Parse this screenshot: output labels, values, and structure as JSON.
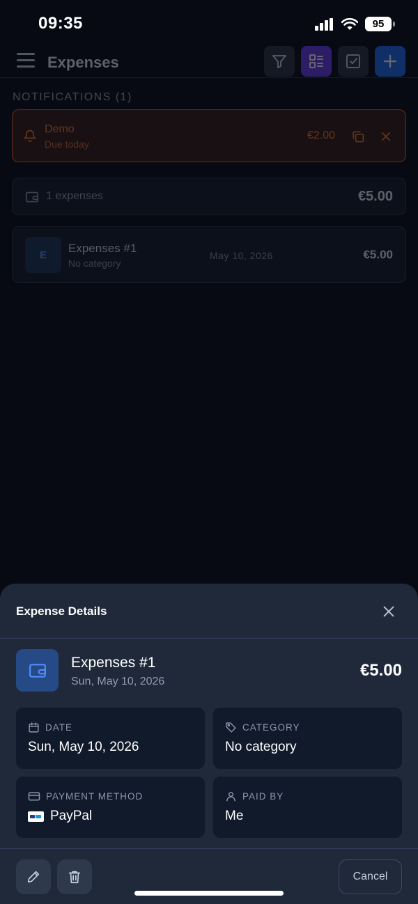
{
  "status_bar": {
    "time": "09:35",
    "battery": "95"
  },
  "header": {
    "title": "Expenses"
  },
  "notifications": {
    "label": "NOTIFICATIONS (1)",
    "items": [
      {
        "name": "Demo",
        "subtitle": "Due today",
        "amount": "€2.00"
      }
    ]
  },
  "summary": {
    "count_label": "1 expenses",
    "total": "€5.00"
  },
  "expenses": [
    {
      "initial": "E",
      "name": "Expenses #1",
      "category": "No category",
      "date": "May 10, 2026",
      "amount": "€5.00"
    }
  ],
  "sheet": {
    "title": "Expense Details",
    "expense": {
      "name": "Expenses #1",
      "date": "Sun, May 10, 2026",
      "amount": "€5.00"
    },
    "fields": {
      "date": {
        "label": "DATE",
        "value": "Sun, May 10, 2026"
      },
      "category": {
        "label": "CATEGORY",
        "value": "No category"
      },
      "payment_method": {
        "label": "PAYMENT METHOD",
        "value": "PayPal"
      },
      "paid_by": {
        "label": "PAID BY",
        "value": "Me"
      }
    },
    "cancel_label": "Cancel"
  },
  "colors": {
    "background": "#070a12",
    "sheet": "#1f293a",
    "accent_purple": "#6a3df0",
    "accent_blue": "#1f6cf2",
    "notification_orange": "#ff6a1a"
  },
  "icons": [
    "menu-icon",
    "filter-icon",
    "list-view-icon",
    "checkbox-icon",
    "plus-icon",
    "bell-icon",
    "copy-icon",
    "close-icon",
    "wallet-icon",
    "calendar-icon",
    "tag-icon",
    "credit-card-icon",
    "user-icon",
    "pencil-icon",
    "trash-icon"
  ]
}
